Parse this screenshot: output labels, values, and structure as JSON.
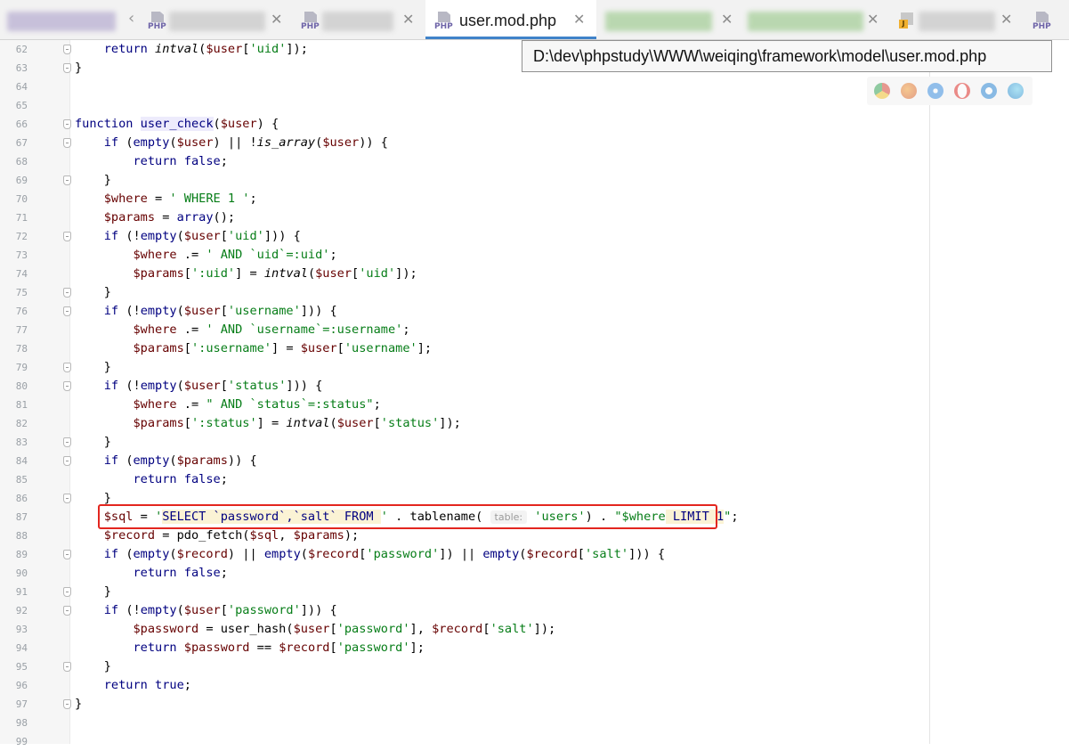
{
  "tabs": {
    "active_title": "user.mod.php",
    "php_badge": "PHP",
    "j_badge": "J"
  },
  "tooltip": {
    "path": "D:\\dev\\phpstudy\\WWW\\weiqing\\framework\\model\\user.mod.php"
  },
  "colors": {
    "keyword": "#000080",
    "variable": "#660000",
    "string": "#067d17",
    "number": "#0000ff",
    "highlight_box": "#e3261f",
    "active_tab_underline": "#4083c9"
  },
  "browser_icons": [
    "chrome-icon",
    "firefox-icon",
    "safari-icon",
    "opera-icon",
    "ie-icon",
    "edge-icon"
  ],
  "editor": {
    "lines": [
      {
        "n": "62",
        "fold": true,
        "segs": [
          [
            "",
            "    "
          ],
          [
            "k",
            "return "
          ],
          [
            "f",
            "intval"
          ],
          [
            "p",
            "("
          ],
          [
            "v",
            "$user"
          ],
          [
            "p",
            "["
          ],
          [
            "s",
            "'uid'"
          ],
          [
            "p",
            "]);"
          ]
        ]
      },
      {
        "n": "63",
        "fold": true,
        "segs": [
          [
            "p",
            "}"
          ]
        ]
      },
      {
        "n": "64",
        "fold": false,
        "segs": []
      },
      {
        "n": "65",
        "fold": false,
        "segs": []
      },
      {
        "n": "66",
        "fold": true,
        "segs": [
          [
            "k",
            "function "
          ],
          [
            "hl",
            "user_check"
          ],
          [
            "p",
            "("
          ],
          [
            "v",
            "$user"
          ],
          [
            "p",
            ") {"
          ]
        ]
      },
      {
        "n": "67",
        "fold": true,
        "segs": [
          [
            "",
            "    "
          ],
          [
            "k",
            "if "
          ],
          [
            "p",
            "("
          ],
          [
            "k",
            "empty"
          ],
          [
            "p",
            "("
          ],
          [
            "v",
            "$user"
          ],
          [
            "p",
            ") || !"
          ],
          [
            "f",
            "is_array"
          ],
          [
            "p",
            "("
          ],
          [
            "v",
            "$user"
          ],
          [
            "p",
            ")) {"
          ]
        ]
      },
      {
        "n": "68",
        "fold": false,
        "segs": [
          [
            "",
            "        "
          ],
          [
            "k",
            "return false"
          ],
          [
            "p",
            ";"
          ]
        ]
      },
      {
        "n": "69",
        "fold": true,
        "segs": [
          [
            "",
            "    "
          ],
          [
            "p",
            "}"
          ]
        ]
      },
      {
        "n": "70",
        "fold": false,
        "segs": [
          [
            "",
            "    "
          ],
          [
            "v",
            "$where"
          ],
          [
            "p",
            " = "
          ],
          [
            "s",
            "' WHERE 1 '"
          ],
          [
            "p",
            ";"
          ]
        ]
      },
      {
        "n": "71",
        "fold": false,
        "segs": [
          [
            "",
            "    "
          ],
          [
            "v",
            "$params"
          ],
          [
            "p",
            " = "
          ],
          [
            "k",
            "array"
          ],
          [
            "p",
            "();"
          ]
        ]
      },
      {
        "n": "72",
        "fold": true,
        "segs": [
          [
            "",
            "    "
          ],
          [
            "k",
            "if "
          ],
          [
            "p",
            "(!"
          ],
          [
            "k",
            "empty"
          ],
          [
            "p",
            "("
          ],
          [
            "v",
            "$user"
          ],
          [
            "p",
            "["
          ],
          [
            "s",
            "'uid'"
          ],
          [
            "p",
            "])) {"
          ]
        ]
      },
      {
        "n": "73",
        "fold": false,
        "segs": [
          [
            "",
            "        "
          ],
          [
            "v",
            "$where"
          ],
          [
            "p",
            " .= "
          ],
          [
            "s",
            "' AND `uid`=:uid'"
          ],
          [
            "p",
            ";"
          ]
        ]
      },
      {
        "n": "74",
        "fold": false,
        "segs": [
          [
            "",
            "        "
          ],
          [
            "v",
            "$params"
          ],
          [
            "p",
            "["
          ],
          [
            "s",
            "':uid'"
          ],
          [
            "p",
            "] = "
          ],
          [
            "f",
            "intval"
          ],
          [
            "p",
            "("
          ],
          [
            "v",
            "$user"
          ],
          [
            "p",
            "["
          ],
          [
            "s",
            "'uid'"
          ],
          [
            "p",
            "]);"
          ]
        ]
      },
      {
        "n": "75",
        "fold": true,
        "segs": [
          [
            "",
            "    "
          ],
          [
            "p",
            "}"
          ]
        ]
      },
      {
        "n": "76",
        "fold": true,
        "segs": [
          [
            "",
            "    "
          ],
          [
            "k",
            "if "
          ],
          [
            "p",
            "(!"
          ],
          [
            "k",
            "empty"
          ],
          [
            "p",
            "("
          ],
          [
            "v",
            "$user"
          ],
          [
            "p",
            "["
          ],
          [
            "s",
            "'username'"
          ],
          [
            "p",
            "])) {"
          ]
        ]
      },
      {
        "n": "77",
        "fold": false,
        "segs": [
          [
            "",
            "        "
          ],
          [
            "v",
            "$where"
          ],
          [
            "p",
            " .= "
          ],
          [
            "s",
            "' AND `username`=:username'"
          ],
          [
            "p",
            ";"
          ]
        ]
      },
      {
        "n": "78",
        "fold": false,
        "segs": [
          [
            "",
            "        "
          ],
          [
            "v",
            "$params"
          ],
          [
            "p",
            "["
          ],
          [
            "s",
            "':username'"
          ],
          [
            "p",
            "] = "
          ],
          [
            "v",
            "$user"
          ],
          [
            "p",
            "["
          ],
          [
            "s",
            "'username'"
          ],
          [
            "p",
            "];"
          ]
        ]
      },
      {
        "n": "79",
        "fold": true,
        "segs": [
          [
            "",
            "    "
          ],
          [
            "p",
            "}"
          ]
        ]
      },
      {
        "n": "80",
        "fold": true,
        "segs": [
          [
            "",
            "    "
          ],
          [
            "k",
            "if "
          ],
          [
            "p",
            "(!"
          ],
          [
            "k",
            "empty"
          ],
          [
            "p",
            "("
          ],
          [
            "v",
            "$user"
          ],
          [
            "p",
            "["
          ],
          [
            "s",
            "'status'"
          ],
          [
            "p",
            "])) {"
          ]
        ]
      },
      {
        "n": "81",
        "fold": false,
        "segs": [
          [
            "",
            "        "
          ],
          [
            "v",
            "$where"
          ],
          [
            "p",
            " .= "
          ],
          [
            "s",
            "\" AND `status`=:status\""
          ],
          [
            "p",
            ";"
          ]
        ]
      },
      {
        "n": "82",
        "fold": false,
        "segs": [
          [
            "",
            "        "
          ],
          [
            "v",
            "$params"
          ],
          [
            "p",
            "["
          ],
          [
            "s",
            "':status'"
          ],
          [
            "p",
            "] = "
          ],
          [
            "f",
            "intval"
          ],
          [
            "p",
            "("
          ],
          [
            "v",
            "$user"
          ],
          [
            "p",
            "["
          ],
          [
            "s",
            "'status'"
          ],
          [
            "p",
            "]);"
          ]
        ]
      },
      {
        "n": "83",
        "fold": true,
        "segs": [
          [
            "",
            "    "
          ],
          [
            "p",
            "}"
          ]
        ]
      },
      {
        "n": "84",
        "fold": true,
        "segs": [
          [
            "",
            "    "
          ],
          [
            "k",
            "if "
          ],
          [
            "p",
            "("
          ],
          [
            "k",
            "empty"
          ],
          [
            "p",
            "("
          ],
          [
            "v",
            "$params"
          ],
          [
            "p",
            ")) {"
          ]
        ]
      },
      {
        "n": "85",
        "fold": false,
        "segs": [
          [
            "",
            "        "
          ],
          [
            "k",
            "return false"
          ],
          [
            "p",
            ";"
          ]
        ]
      },
      {
        "n": "86",
        "fold": true,
        "segs": [
          [
            "",
            "    "
          ],
          [
            "p",
            "}"
          ]
        ]
      },
      {
        "n": "87",
        "fold": false,
        "segs": [
          [
            "",
            "    "
          ],
          [
            "v",
            "$sql"
          ],
          [
            "p",
            " = "
          ],
          [
            "s",
            "'"
          ],
          [
            "sq",
            "SELECT `password`,`salt` FROM "
          ],
          [
            "s",
            "'"
          ],
          [
            "p",
            " . tablename( "
          ],
          [
            "hint",
            "table:"
          ],
          [
            "s",
            " 'users'"
          ],
          [
            "p",
            ") . "
          ],
          [
            "s",
            "\"$where"
          ],
          [
            "sq",
            " LIMIT 1"
          ],
          [
            "s",
            "\""
          ],
          [
            "p",
            ";"
          ]
        ]
      },
      {
        "n": "88",
        "fold": false,
        "segs": [
          [
            "",
            "    "
          ],
          [
            "v",
            "$record"
          ],
          [
            "p",
            " = pdo_fetch("
          ],
          [
            "v",
            "$sql"
          ],
          [
            "p",
            ", "
          ],
          [
            "v",
            "$params"
          ],
          [
            "p",
            ");"
          ]
        ]
      },
      {
        "n": "89",
        "fold": true,
        "segs": [
          [
            "",
            "    "
          ],
          [
            "k",
            "if "
          ],
          [
            "p",
            "("
          ],
          [
            "k",
            "empty"
          ],
          [
            "p",
            "("
          ],
          [
            "v",
            "$record"
          ],
          [
            "p",
            ") || "
          ],
          [
            "k",
            "empty"
          ],
          [
            "p",
            "("
          ],
          [
            "v",
            "$record"
          ],
          [
            "p",
            "["
          ],
          [
            "s",
            "'password'"
          ],
          [
            "p",
            "]) || "
          ],
          [
            "k",
            "empty"
          ],
          [
            "p",
            "("
          ],
          [
            "v",
            "$record"
          ],
          [
            "p",
            "["
          ],
          [
            "s",
            "'salt'"
          ],
          [
            "p",
            "])) {"
          ]
        ]
      },
      {
        "n": "90",
        "fold": false,
        "segs": [
          [
            "",
            "        "
          ],
          [
            "k",
            "return false"
          ],
          [
            "p",
            ";"
          ]
        ]
      },
      {
        "n": "91",
        "fold": true,
        "segs": [
          [
            "",
            "    "
          ],
          [
            "p",
            "}"
          ]
        ]
      },
      {
        "n": "92",
        "fold": true,
        "segs": [
          [
            "",
            "    "
          ],
          [
            "k",
            "if "
          ],
          [
            "p",
            "(!"
          ],
          [
            "k",
            "empty"
          ],
          [
            "p",
            "("
          ],
          [
            "v",
            "$user"
          ],
          [
            "p",
            "["
          ],
          [
            "s",
            "'password'"
          ],
          [
            "p",
            "])) {"
          ]
        ]
      },
      {
        "n": "93",
        "fold": false,
        "segs": [
          [
            "",
            "        "
          ],
          [
            "v",
            "$password"
          ],
          [
            "p",
            " = user_hash("
          ],
          [
            "v",
            "$user"
          ],
          [
            "p",
            "["
          ],
          [
            "s",
            "'password'"
          ],
          [
            "p",
            "], "
          ],
          [
            "v",
            "$record"
          ],
          [
            "p",
            "["
          ],
          [
            "s",
            "'salt'"
          ],
          [
            "p",
            "]);"
          ]
        ]
      },
      {
        "n": "94",
        "fold": false,
        "segs": [
          [
            "",
            "        "
          ],
          [
            "k",
            "return "
          ],
          [
            "v",
            "$password"
          ],
          [
            "p",
            " == "
          ],
          [
            "v",
            "$record"
          ],
          [
            "p",
            "["
          ],
          [
            "s",
            "'password'"
          ],
          [
            "p",
            "];"
          ]
        ]
      },
      {
        "n": "95",
        "fold": true,
        "segs": [
          [
            "",
            "    "
          ],
          [
            "p",
            "}"
          ]
        ]
      },
      {
        "n": "96",
        "fold": false,
        "segs": [
          [
            "",
            "    "
          ],
          [
            "k",
            "return true"
          ],
          [
            "p",
            ";"
          ]
        ]
      },
      {
        "n": "97",
        "fold": true,
        "segs": [
          [
            "p",
            "}"
          ]
        ]
      },
      {
        "n": "98",
        "fold": false,
        "segs": []
      },
      {
        "n": "99",
        "fold": false,
        "segs": []
      }
    ]
  }
}
